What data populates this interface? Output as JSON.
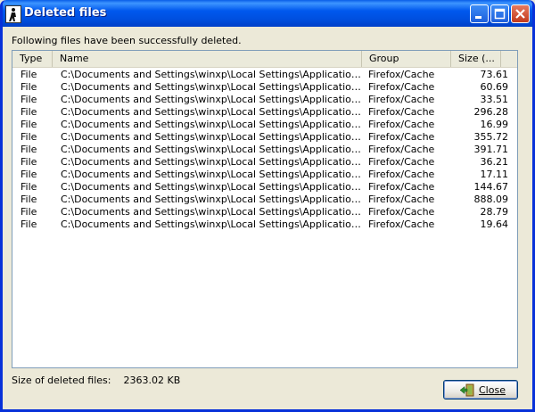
{
  "window": {
    "title": "Deleted files",
    "controls": {
      "minimize": "minimize",
      "maximize": "maximize",
      "close": "close"
    }
  },
  "message": "Following files have been successfully deleted.",
  "list": {
    "columns": [
      "Type",
      "Name",
      "Group",
      "Size (..."
    ],
    "rows": [
      {
        "type": "File",
        "name": "C:\\Documents and Settings\\winxp\\Local Settings\\Application Data\\...",
        "group": "Firefox/Cache",
        "size": "73.61"
      },
      {
        "type": "File",
        "name": "C:\\Documents and Settings\\winxp\\Local Settings\\Application Data\\...",
        "group": "Firefox/Cache",
        "size": "60.69"
      },
      {
        "type": "File",
        "name": "C:\\Documents and Settings\\winxp\\Local Settings\\Application Data\\...",
        "group": "Firefox/Cache",
        "size": "33.51"
      },
      {
        "type": "File",
        "name": "C:\\Documents and Settings\\winxp\\Local Settings\\Application Data\\...",
        "group": "Firefox/Cache",
        "size": "296.28"
      },
      {
        "type": "File",
        "name": "C:\\Documents and Settings\\winxp\\Local Settings\\Application Data\\...",
        "group": "Firefox/Cache",
        "size": "16.99"
      },
      {
        "type": "File",
        "name": "C:\\Documents and Settings\\winxp\\Local Settings\\Application Data\\...",
        "group": "Firefox/Cache",
        "size": "355.72"
      },
      {
        "type": "File",
        "name": "C:\\Documents and Settings\\winxp\\Local Settings\\Application Data\\...",
        "group": "Firefox/Cache",
        "size": "391.71"
      },
      {
        "type": "File",
        "name": "C:\\Documents and Settings\\winxp\\Local Settings\\Application Data\\...",
        "group": "Firefox/Cache",
        "size": "36.21"
      },
      {
        "type": "File",
        "name": "C:\\Documents and Settings\\winxp\\Local Settings\\Application Data\\...",
        "group": "Firefox/Cache",
        "size": "17.11"
      },
      {
        "type": "File",
        "name": "C:\\Documents and Settings\\winxp\\Local Settings\\Application Data\\...",
        "group": "Firefox/Cache",
        "size": "144.67"
      },
      {
        "type": "File",
        "name": "C:\\Documents and Settings\\winxp\\Local Settings\\Application Data\\...",
        "group": "Firefox/Cache",
        "size": "888.09"
      },
      {
        "type": "File",
        "name": "C:\\Documents and Settings\\winxp\\Local Settings\\Application Data\\...",
        "group": "Firefox/Cache",
        "size": "28.79"
      },
      {
        "type": "File",
        "name": "C:\\Documents and Settings\\winxp\\Local Settings\\Application Data\\...",
        "group": "Firefox/Cache",
        "size": "19.64"
      }
    ]
  },
  "footer": {
    "size_label": "Size of deleted files:",
    "size_value": "2363.02 KB",
    "close_label": "Close",
    "close_icon": "exit-door-icon"
  },
  "colors": {
    "titlebar": "#0058EE",
    "face": "#ECE9D8",
    "border": "#0831D9"
  }
}
